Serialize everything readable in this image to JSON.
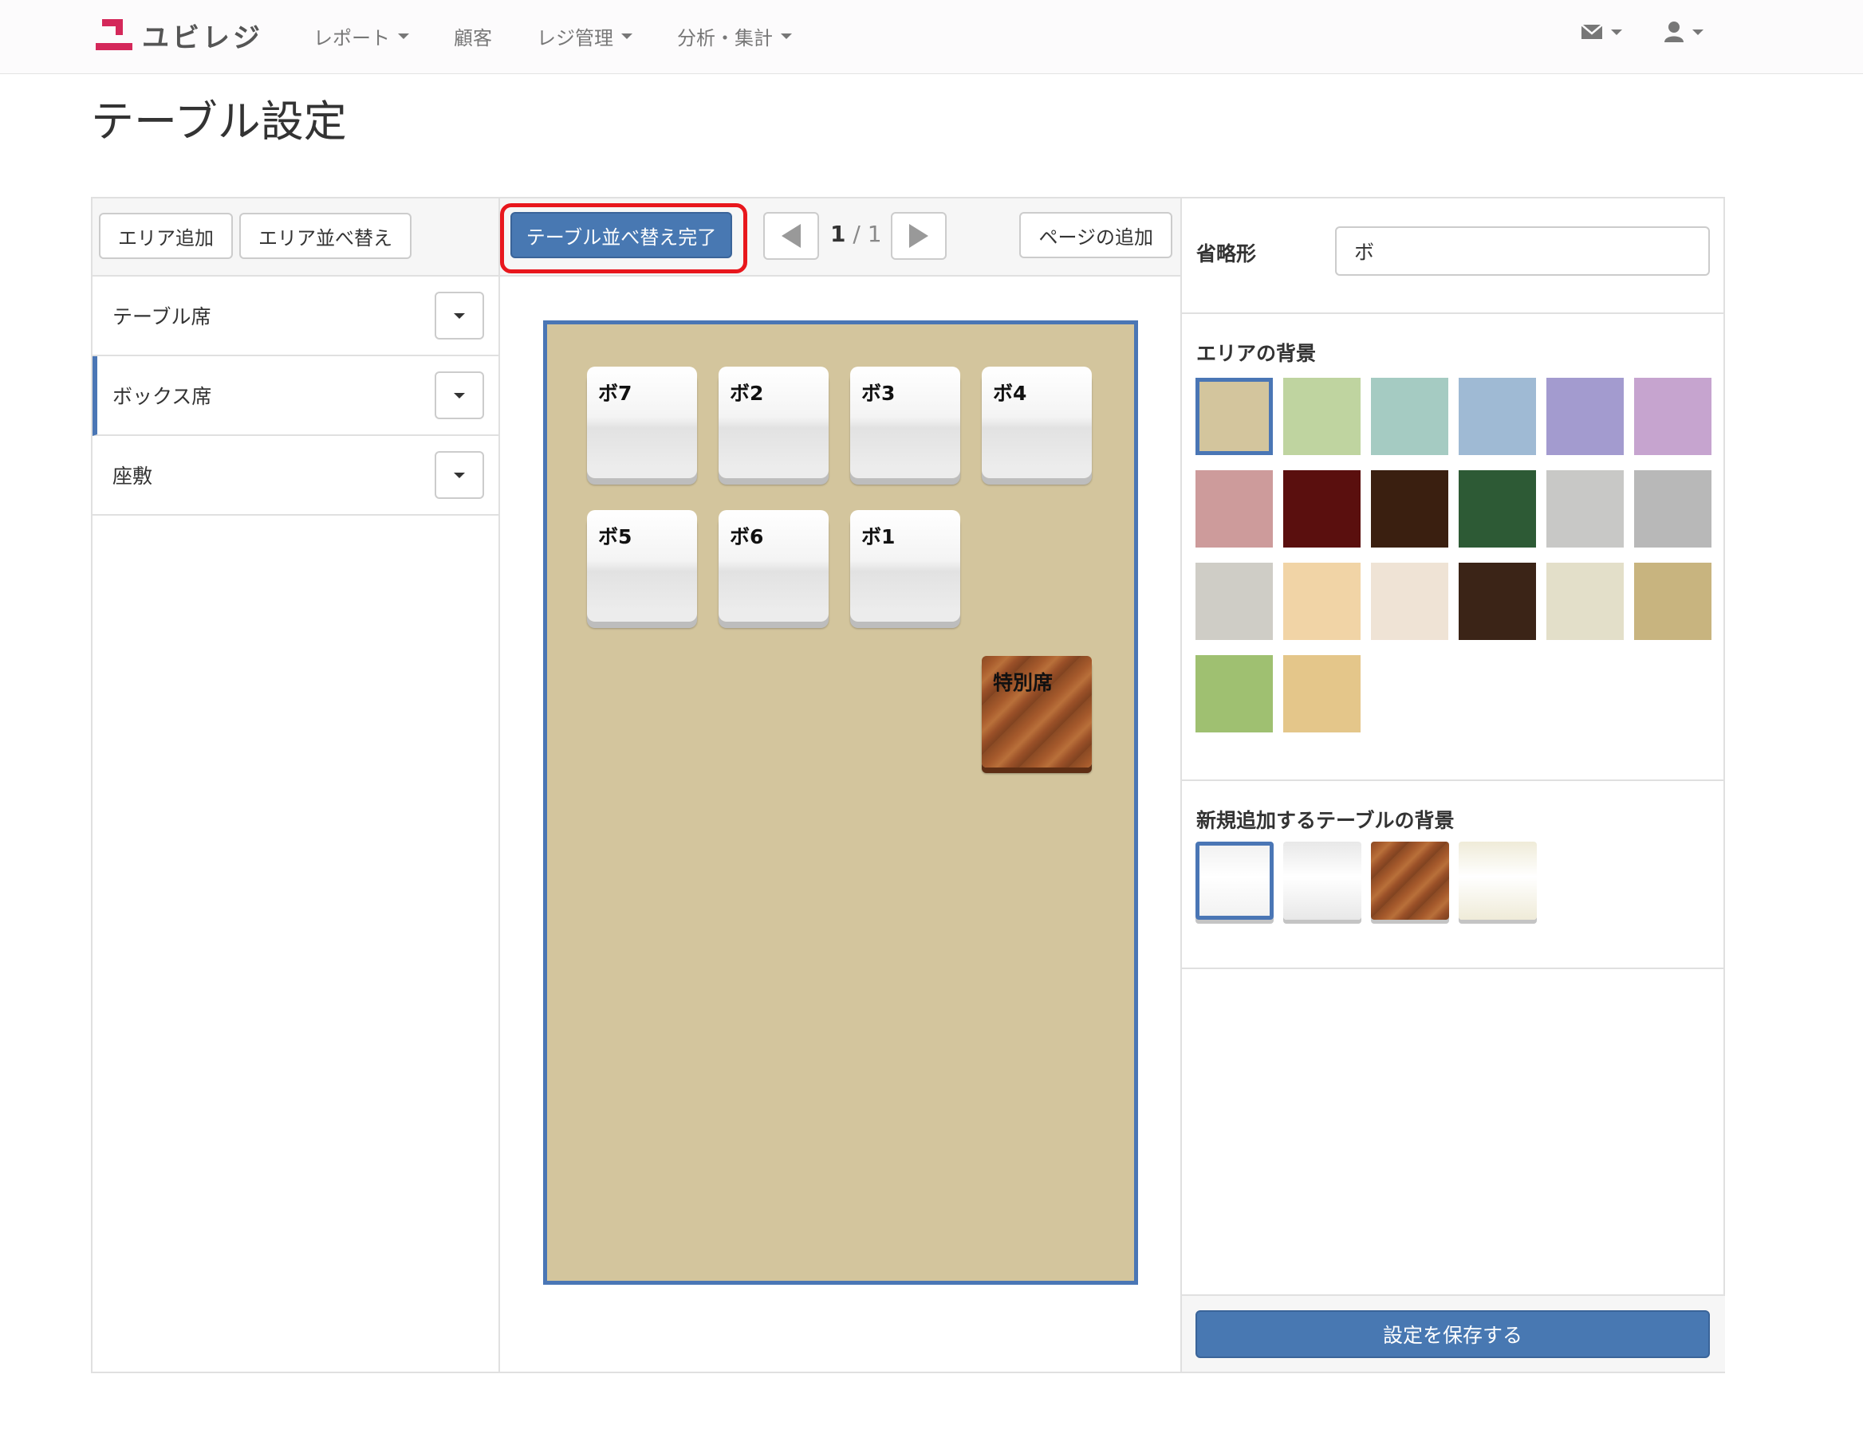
{
  "brand": {
    "name": "ユビレジ",
    "accent": "#d4285a"
  },
  "nav": {
    "items": [
      {
        "label": "レポート",
        "dropdown": true
      },
      {
        "label": "顧客",
        "dropdown": false
      },
      {
        "label": "レジ管理",
        "dropdown": true
      },
      {
        "label": "分析・集計",
        "dropdown": true
      }
    ],
    "icons": [
      "envelope-icon",
      "user-icon"
    ]
  },
  "page": {
    "title": "テーブル設定"
  },
  "left": {
    "add_area_label": "エリア追加",
    "sort_area_label": "エリア並べ替え",
    "areas": [
      {
        "name": "テーブル席",
        "active": false
      },
      {
        "name": "ボックス席",
        "active": true
      },
      {
        "name": "座敷",
        "active": false
      }
    ]
  },
  "center": {
    "finish_sort_label": "テーブル並べ替え完了",
    "page_current": "1",
    "page_total": "1",
    "page_sep": "/",
    "add_page_label": "ページの追加",
    "area_background": "#d3c59d",
    "tables": [
      {
        "label": "ボ7",
        "style": "white"
      },
      {
        "label": "ボ2",
        "style": "white"
      },
      {
        "label": "ボ3",
        "style": "white"
      },
      {
        "label": "ボ4",
        "style": "white"
      },
      {
        "label": "ボ5",
        "style": "white"
      },
      {
        "label": "ボ6",
        "style": "white"
      },
      {
        "label": "ボ1",
        "style": "white"
      },
      {
        "label": "特別席",
        "style": "wood"
      }
    ]
  },
  "right": {
    "abbr_label": "省略形",
    "abbr_value": "ボ",
    "area_bg_title": "エリアの背景",
    "area_bg_swatches": [
      "#d3c59d",
      "#bfd4a0",
      "#a5cbc2",
      "#9fbad4",
      "#a39bcf",
      "#c6a4cf",
      "#cd9b9b",
      "#5a0f0e",
      "#3a1f10",
      "#2d5a35",
      "#c8c8c6",
      "#b8b8b8",
      "#cfcdc6",
      "#f1d4a6",
      "#efe3d5",
      "#3b2417",
      "#e3dfc9",
      "#c8b47f",
      "#9fc071",
      "#e4c68a"
    ],
    "area_bg_selected": 0,
    "table_bg_title": "新規追加するテーブルの背景",
    "table_bg_swatches": [
      "#f2f2f2",
      "#e8e8e8",
      "#a8582c",
      "#efebd8"
    ],
    "table_bg_selected": 0,
    "save_label": "設定を保存する"
  }
}
